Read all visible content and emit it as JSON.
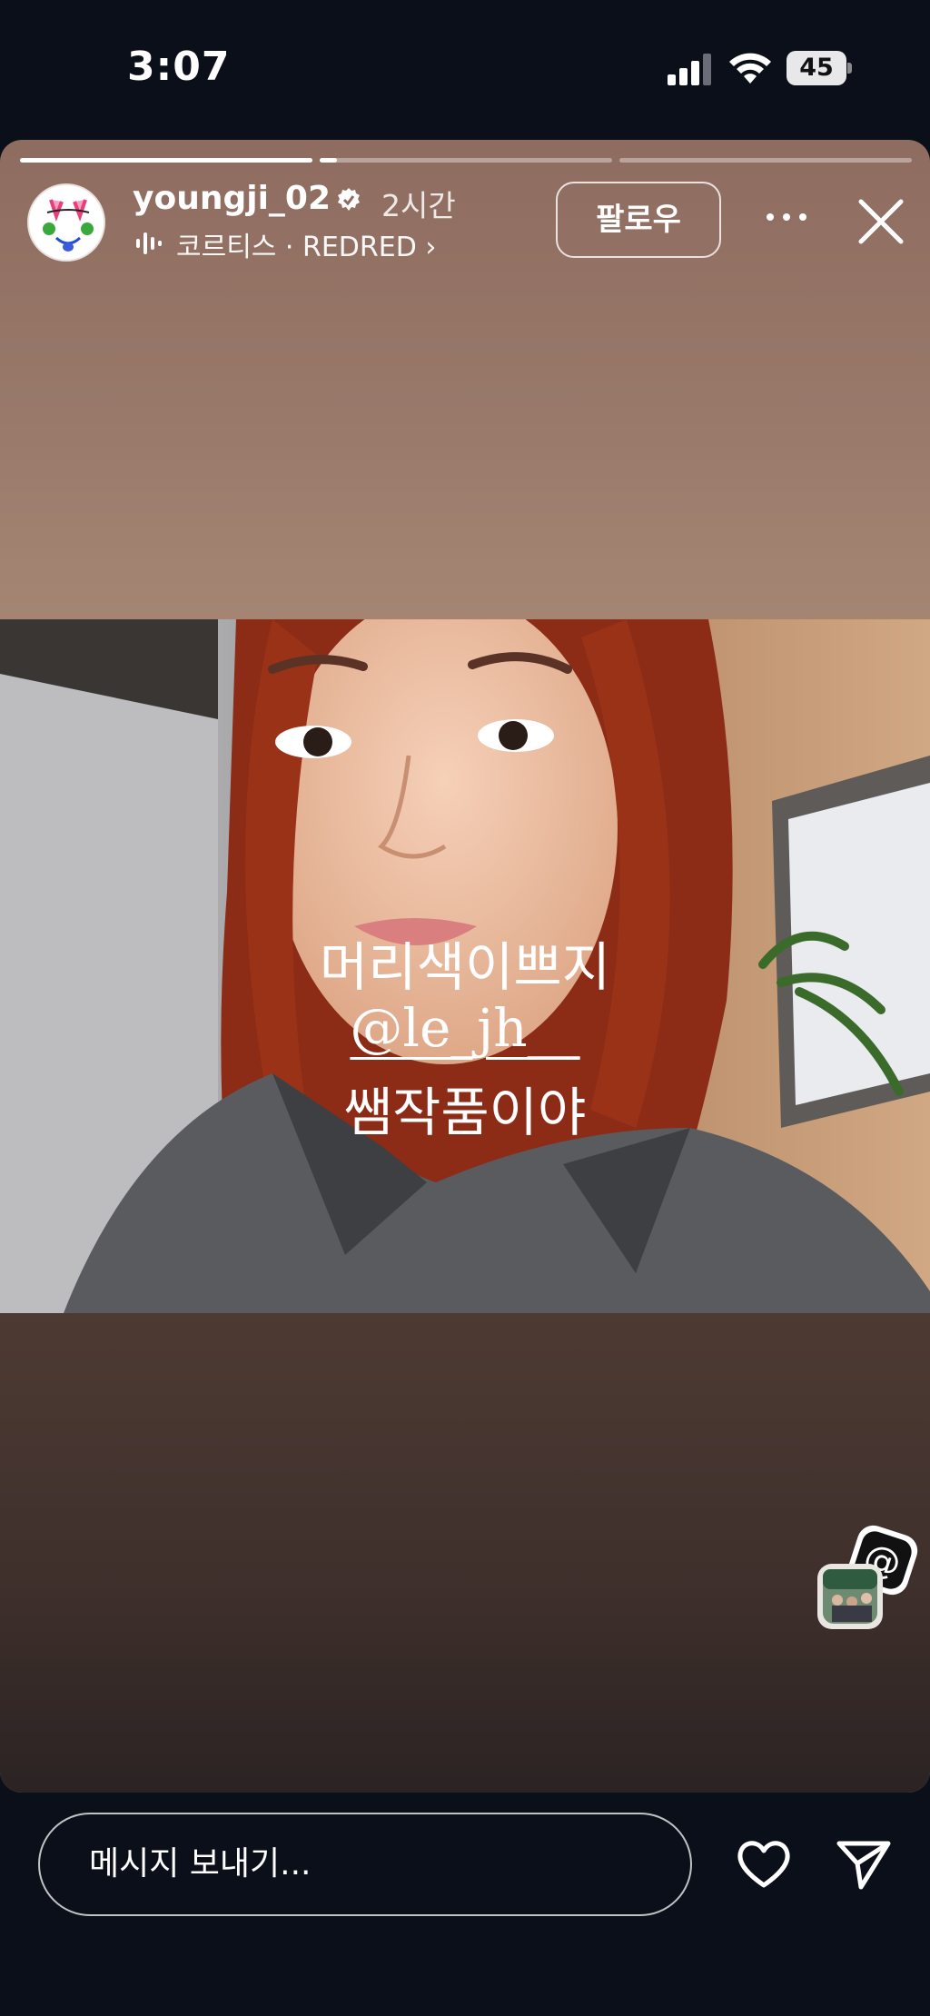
{
  "status_bar": {
    "time": "3:07",
    "battery": "45"
  },
  "story": {
    "progress": [
      {
        "fill": 1.0
      },
      {
        "fill": 0.06
      },
      {
        "fill": 0.0
      }
    ],
    "username": "youngji_02",
    "posted": "2시간",
    "music": "코르티스 · REDRED ›",
    "follow_label": "팔로우",
    "caption": {
      "line1": "머리색이쁘지",
      "mention": "@le_jh__",
      "line3": "쌤작품이야"
    }
  },
  "bottom_bar": {
    "message_placeholder": "메시지 보내기..."
  }
}
